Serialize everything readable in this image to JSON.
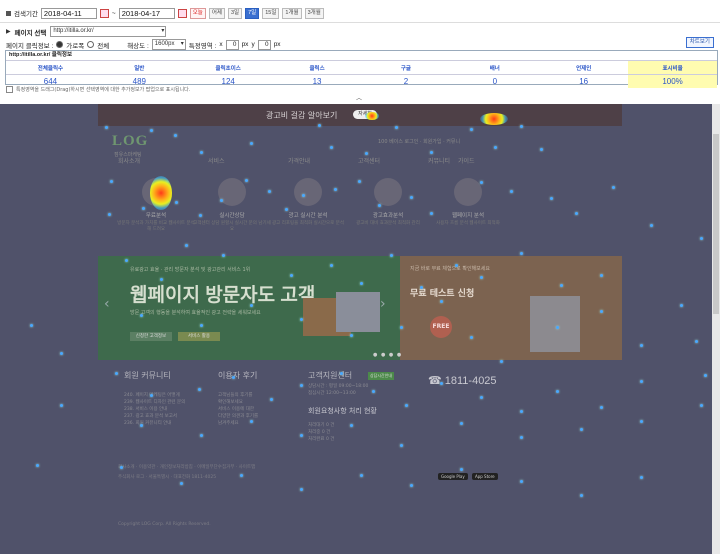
{
  "filters": {
    "period_label": "검색기간",
    "date_from": "2018-04-11",
    "date_sep": "~",
    "date_to": "2018-04-17",
    "quick_ranges": [
      "오늘",
      "어제",
      "3일",
      "7일",
      "15일",
      "1개월",
      "3개월"
    ],
    "page_select_label": "페이지 선택",
    "page_url": "http://itilla.or.kr/",
    "click_info_label": "페이지 클릭정보 :",
    "scope_options": [
      "가로폭",
      "전체"
    ],
    "accuracy_label": "해상도 :",
    "accuracy_value": "1600px",
    "coord_label": "특정영역 :",
    "coord_x_label": "x",
    "coord_x_value": "0",
    "coord_px1": "px",
    "coord_y_label": "y",
    "coord_y_value": "0",
    "coord_px2": "px",
    "chart_button": "차트보기"
  },
  "stats": {
    "title": "http://itilla.or.kr/ 클릭정보",
    "columns": [
      "전체클릭수",
      "일반",
      "클릭초이스",
      "클릭스",
      "구글",
      "배너",
      "언제인",
      "표시비율"
    ],
    "values": [
      "644",
      "489",
      "124",
      "13",
      "2",
      "0",
      "16",
      "100%"
    ]
  },
  "note": "특정영역을 드래그(Drag)하시면 선택영역에 대한 추가정보가 팝업으로 표시됩니다.",
  "heatmap": {
    "site": {
      "banner_text": "광고비 걸감 알아보기",
      "banner_pill": "자세히",
      "logo": "LOG",
      "logo_sub": "점유스마케팅",
      "toplinks": "100 베이스 로그인 · 회원가입 · 커뮤니",
      "nav": [
        "회사소개",
        "서비스",
        "가격안내",
        "고객센터",
        "커뮤니티",
        "가이드"
      ],
      "icons": [
        {
          "title": "무료분석",
          "desc": "방문자 분석과 가치를 비교 웹사이트 분석해 드려요"
        },
        {
          "title": "실시간상담",
          "desc": "고객센터 상담 원할시 실시간 문의 남기세요"
        },
        {
          "title": "광고 실시간 분석",
          "desc": "광고 리포팅을 최적화 실시간으로 분석"
        },
        {
          "title": "광고효과분석",
          "desc": "광고비 대비 효과분석 최적화 관리"
        },
        {
          "title": "웹페이지 분석",
          "desc": "사용자 흐름 분석 웹사이트 최적화"
        }
      ],
      "slider_sub": "유료광고 효율 · 관리 방문자 분석 및 광고관리 서비스 1위",
      "slider_title": "웹페이지 방문자도 고객",
      "slider_desc": "방문 고객의 행동을 분석하여 효율적인 광고 전략을 세워보세요",
      "slider_btn1": "신청한 고객정보",
      "slider_btn2": "서비스 활용",
      "promo_sub": "지금 바로 무료 체험으로 확인해보세요",
      "promo_title": "무료 테스트 신청",
      "promo_free": "FREE",
      "col1_title": "회원 커뮤니티",
      "col1_lines": [
        "240. 페이지 마케팅은 어떻게",
        "239. 웹사이트 디자인 관련 문의",
        "238. 서비스 이용 안내",
        "237. 광고 효과 분석 보고서",
        "236. 회원 커뮤니티 안내"
      ],
      "col2_title": "이용자 후기",
      "col2_lines": [
        "고객님들의 후기를",
        "확인해보세요",
        "서비스 이용에 대한",
        "다양한 의견과 후기를",
        "남겨주세요"
      ],
      "col3_title": "고객지원센터",
      "col3_tag": "상담시간안내",
      "col3_lines": [
        "상담시간 : 평일 09:00~18:00",
        "점심시간 12:00~13:00"
      ],
      "phone": "☎ 1811-4025",
      "proc_title": "회원요청사항 처리 현황",
      "proc_lines": [
        "처리대기 0 건",
        "처리중 0 건",
        "처리완료 0 건"
      ],
      "footer_links": "회사소개 · 이용약관 · 개인정보처리방침 · 이메일무단수집거부 · 사이트맵",
      "footer_addr": "주식회사 로그 · 서울특별시 · 대표전화 1811-4025",
      "footer_copy": "Copyright LOG Corp. All Rights Reserved.",
      "stores": [
        "Google Play",
        "App Store"
      ]
    }
  }
}
